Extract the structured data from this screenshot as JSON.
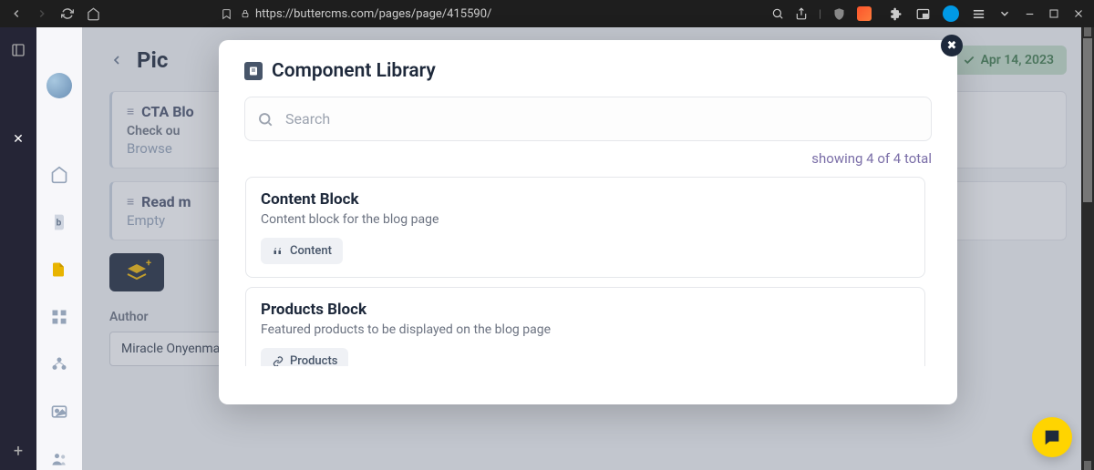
{
  "browser": {
    "url": "https://buttercms.com/pages/page/415590/"
  },
  "page": {
    "title_partial": "Pic",
    "date_label": "Apr 14, 2023"
  },
  "blocks": {
    "cta": {
      "title": "CTA Blo",
      "line1": "Check ou",
      "line2": "Browse"
    },
    "read": {
      "title": "Read m",
      "line1": "Empty"
    }
  },
  "author": {
    "label": "Author",
    "value": "Miracle Onyenma"
  },
  "modal": {
    "title": "Component Library",
    "search_placeholder": "Search",
    "showing": "showing 4 of 4 total",
    "items": [
      {
        "name": "Content Block",
        "desc": "Content block for the blog page",
        "chip": "Content"
      },
      {
        "name": "Products Block",
        "desc": "Featured products to be displayed on the blog page",
        "chip": "Products"
      }
    ]
  }
}
